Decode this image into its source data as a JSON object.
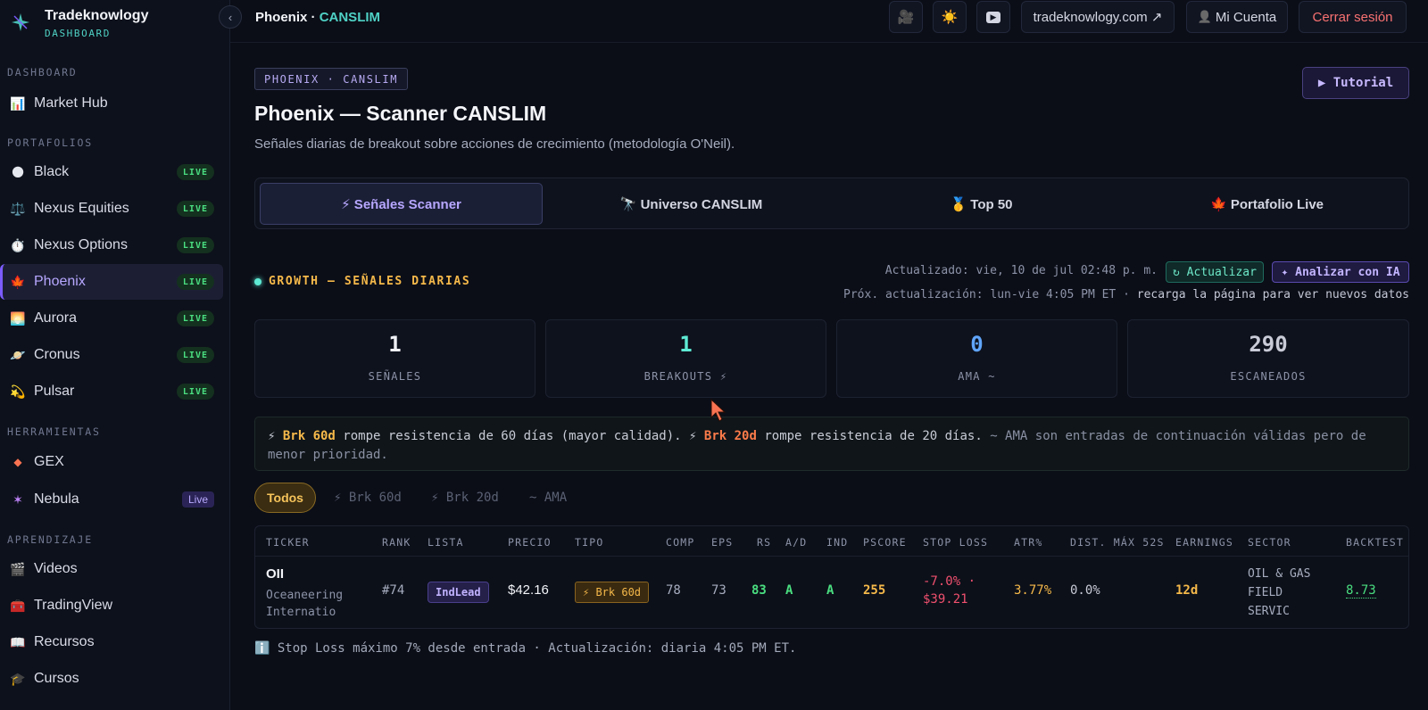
{
  "brand": {
    "name": "Tradeknowlogy",
    "subtitle": "DASHBOARD"
  },
  "sidebar": {
    "collapse_glyph": "‹",
    "sections": {
      "dashboard": "DASHBOARD",
      "portfolios": "PORTAFOLIOS",
      "tools": "HERRAMIENTAS",
      "learning": "APRENDIZAJE"
    },
    "items": [
      {
        "label": "Market Hub",
        "icon": "📊"
      },
      {
        "label": "Black",
        "icon": "🌑",
        "badge": "LIVE"
      },
      {
        "label": "Nexus Equities",
        "icon": "⚖️",
        "badge": "LIVE"
      },
      {
        "label": "Nexus Options",
        "icon": "⏱️",
        "badge": "LIVE"
      },
      {
        "label": "Phoenix",
        "icon": "🍁",
        "badge": "LIVE"
      },
      {
        "label": "Aurora",
        "icon": "🌅",
        "badge": "LIVE"
      },
      {
        "label": "Cronus",
        "icon": "🪐",
        "badge": "LIVE"
      },
      {
        "label": "Pulsar",
        "icon": "💫",
        "badge": "LIVE"
      },
      {
        "label": "GEX",
        "icon": "◆"
      },
      {
        "label": "Nebula",
        "icon": "✶",
        "badge": "Live"
      },
      {
        "label": "Videos",
        "icon": "🎬"
      },
      {
        "label": "TradingView",
        "icon": "🧰"
      },
      {
        "label": "Recursos",
        "icon": "📖"
      },
      {
        "label": "Cursos",
        "icon": "🎓"
      }
    ]
  },
  "topbar": {
    "title_main": "Phoenix · ",
    "title_accent": "CANSLIM",
    "btn_camera": "🎥",
    "btn_theme": "☀️",
    "btn_youtube": "▶",
    "site_link": "tradeknowlogy.com ↗",
    "account": "Mi Cuenta",
    "account_icon": "👤",
    "logout": "Cerrar sesión"
  },
  "header": {
    "chip": "PHOENIX · CANSLIM",
    "tutorial": "▶ Tutorial",
    "title": "Phoenix — Scanner CANSLIM",
    "subtitle": "Señales diarias de breakout sobre acciones de crecimiento (metodología O'Neil)."
  },
  "tabs": [
    {
      "label": "⚡ Señales Scanner"
    },
    {
      "label": "🔭 Universo CANSLIM"
    },
    {
      "label": "🥇 Top 50"
    },
    {
      "label": "🍁 Portafolio Live"
    }
  ],
  "signals": {
    "section_label": "GROWTH — SEÑALES DIARIAS",
    "updated": "Actualizado: vie, 10 de jul 02:48 p. m.",
    "refresh": "↻ Actualizar",
    "ai": "✦ Analizar con IA",
    "next_prefix": "Próx. actualización: lun-vie 4:05 PM ET · ",
    "next_suffix": "recarga la página para ver nuevos datos"
  },
  "stats": [
    {
      "value": "1",
      "label": "SEÑALES",
      "color": "#eef0f5"
    },
    {
      "value": "1",
      "label": "BREAKOUTS ⚡",
      "color": "#5eead4"
    },
    {
      "value": "0",
      "label": "AMA ~",
      "color": "#60a5fa"
    },
    {
      "value": "290",
      "label": "ESCANEADOS",
      "color": "#c9ccd6"
    }
  ],
  "legend": {
    "p1": "⚡ ",
    "brk60": "Brk 60d",
    "p2": " rompe resistencia de 60 días (mayor calidad). ⚡ ",
    "brk20": "Brk 20d",
    "p3": " rompe resistencia de 20 días. ",
    "p4": "~ AMA son entradas de continuación válidas pero de menor prioridad."
  },
  "filters": [
    "Todos",
    "⚡ Brk 60d",
    "⚡ Brk 20d",
    "~ AMA"
  ],
  "table": {
    "headers": [
      "TICKER",
      "RANK",
      "LISTA",
      "PRECIO",
      "TIPO",
      "COMP",
      "EPS",
      "RS",
      "A/D",
      "IND",
      "PSCORE",
      "STOP LOSS",
      "ATR%",
      "DIST. MÁX 52S",
      "EARNINGS",
      "SECTOR",
      "BACKTEST"
    ],
    "row": {
      "ticker": "OII",
      "company": "Oceaneering Internatio",
      "rank": "#74",
      "lista": "IndLead",
      "precio": "$42.16",
      "tipo": "⚡ Brk 60d",
      "comp": "78",
      "eps": "73",
      "rs": "83",
      "ad": "A",
      "ind": "A",
      "pscore": "255",
      "stop_pct": "-7.0% ·",
      "stop_price": "$39.21",
      "atr": "3.77%",
      "dist": "0.0%",
      "earnings": "12d",
      "sector": "OIL & GAS FIELD SERVIC",
      "backtest": "8.73"
    }
  },
  "footnote": "ℹ️ Stop Loss máximo 7% desde entrada · Actualización: diaria 4:05 PM ET."
}
